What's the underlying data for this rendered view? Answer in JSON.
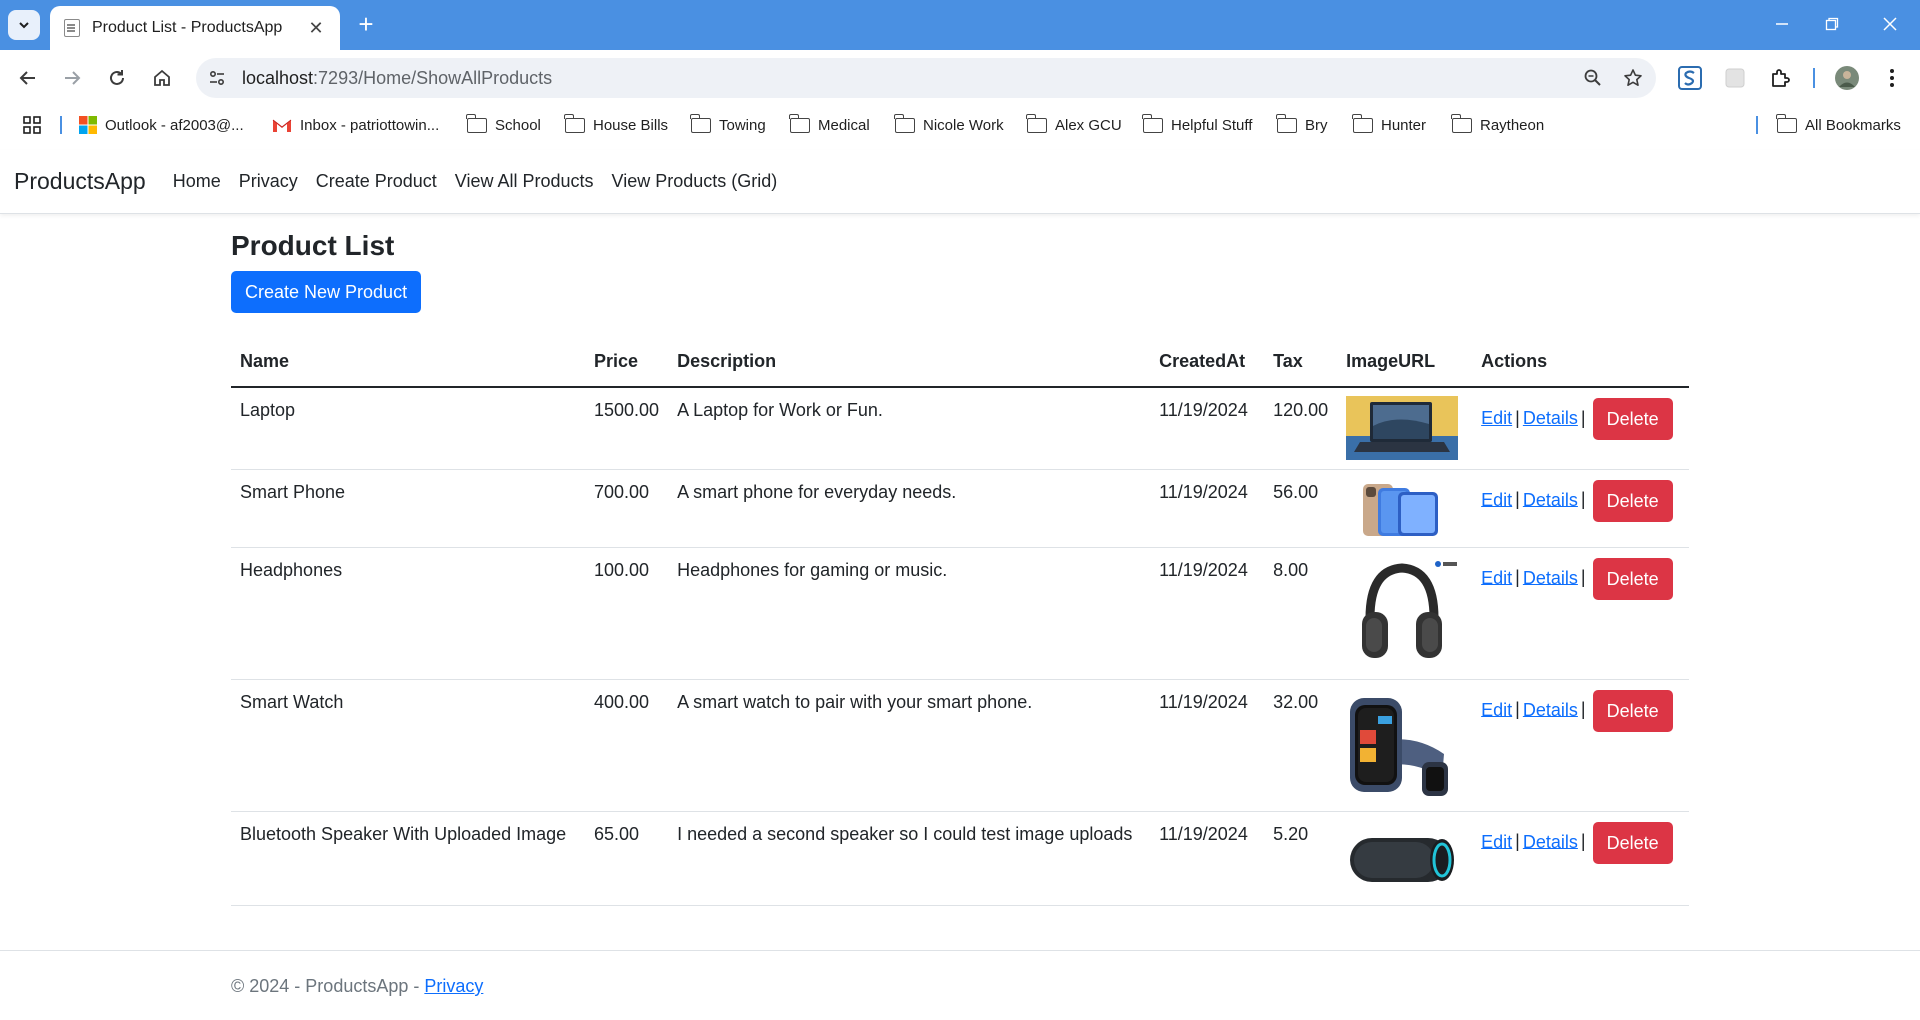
{
  "browser": {
    "tab_title": "Product List - ProductsApp",
    "url_host": "localhost",
    "url_path": ":7293/Home/ShowAllProducts",
    "bookmarks": [
      {
        "label": "Outlook - af2003@...",
        "icon": "windows-logo-icon"
      },
      {
        "label": "Inbox - patriottowin...",
        "icon": "gmail-icon"
      },
      {
        "label": "School",
        "icon": "folder-icon"
      },
      {
        "label": "House Bills",
        "icon": "folder-icon"
      },
      {
        "label": "Towing",
        "icon": "folder-icon"
      },
      {
        "label": "Medical",
        "icon": "folder-icon"
      },
      {
        "label": "Nicole Work",
        "icon": "folder-icon"
      },
      {
        "label": "Alex GCU",
        "icon": "folder-icon"
      },
      {
        "label": "Helpful Stuff",
        "icon": "folder-icon"
      },
      {
        "label": "Bry",
        "icon": "folder-icon"
      },
      {
        "label": "Hunter",
        "icon": "folder-icon"
      },
      {
        "label": "Raytheon",
        "icon": "folder-icon"
      }
    ],
    "all_bookmarks": "All Bookmarks"
  },
  "navbar": {
    "brand": "ProductsApp",
    "links": [
      "Home",
      "Privacy",
      "Create Product",
      "View All Products",
      "View Products (Grid)"
    ]
  },
  "main": {
    "title": "Product List",
    "create_button": "Create New Product",
    "table": {
      "headers": [
        "Name",
        "Price",
        "Description",
        "CreatedAt",
        "Tax",
        "ImageURL",
        "Actions"
      ],
      "rows": [
        {
          "name": "Laptop",
          "price": "1500.00",
          "description": "A Laptop for Work or Fun.",
          "created_at": "11/19/2024",
          "tax": "120.00",
          "image": "laptop"
        },
        {
          "name": "Smart Phone",
          "price": "700.00",
          "description": "A smart phone for everyday needs.",
          "created_at": "11/19/2024",
          "tax": "56.00",
          "image": "smartphone"
        },
        {
          "name": "Headphones",
          "price": "100.00",
          "description": "Headphones for gaming or music.",
          "created_at": "11/19/2024",
          "tax": "8.00",
          "image": "headphones"
        },
        {
          "name": "Smart Watch",
          "price": "400.00",
          "description": "A smart watch to pair with your smart phone.",
          "created_at": "11/19/2024",
          "tax": "32.00",
          "image": "smartwatch"
        },
        {
          "name": "Bluetooth Speaker With Uploaded Image",
          "price": "65.00",
          "description": "I needed a second speaker so I could test image uploads",
          "created_at": "11/19/2024",
          "tax": "5.20",
          "image": "speaker"
        }
      ]
    },
    "actions": {
      "edit": "Edit",
      "details": "Details",
      "delete": "Delete",
      "separator": "|"
    }
  },
  "footer": {
    "text": "© 2024 - ProductsApp - ",
    "privacy": "Privacy"
  },
  "colors": {
    "primary": "#0d6efd",
    "danger": "#dc3545",
    "chrome_blue": "#4a90e2"
  }
}
